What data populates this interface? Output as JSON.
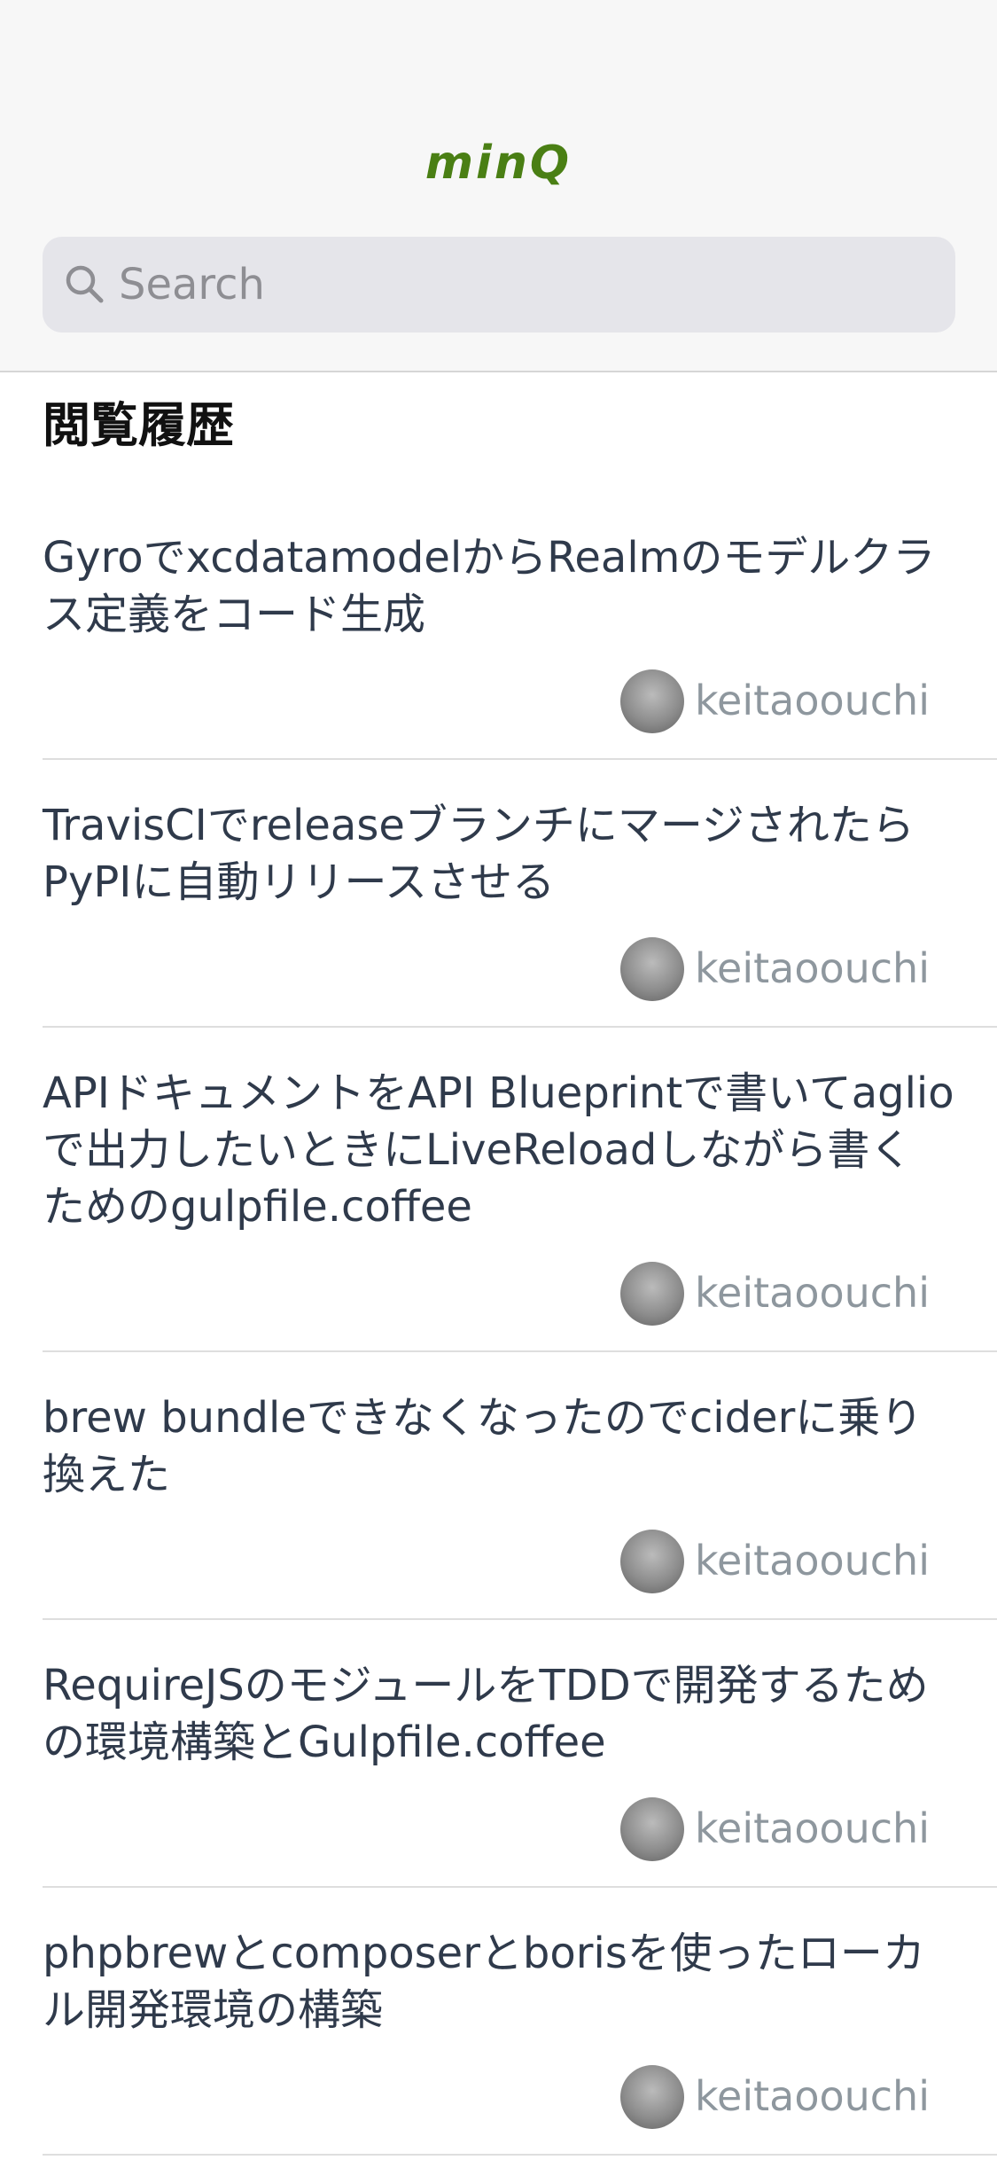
{
  "app": {
    "logo_text": "minQ",
    "brand_color": "#4a7f14"
  },
  "search": {
    "placeholder": "Search",
    "value": "",
    "icon": "magnifying-glass"
  },
  "history": {
    "title": "閲覧履歴",
    "items": [
      {
        "title": "GyroでxcdatamodelからRealmのモデルクラス定義をコード生成",
        "author": "keitaoouchi"
      },
      {
        "title": "TravisCIでreleaseブランチにマージされたらPyPIに自動リリースさせる",
        "author": "keitaoouchi"
      },
      {
        "title": "APIドキュメントをAPI Blueprintで書いてaglioで出力したいときにLiveReloadしながら書くためのgulpfile.coffee",
        "author": "keitaoouchi"
      },
      {
        "title": "brew bundleできなくなったのでciderに乗り換えた",
        "author": "keitaoouchi"
      },
      {
        "title": "RequireJSのモジュールをTDDで開発するための環境構築とGulpfile.coffee",
        "author": "keitaoouchi"
      },
      {
        "title": "phpbrewとcomposerとborisを使ったローカル開発環境の構築",
        "author": "keitaoouchi"
      }
    ]
  }
}
